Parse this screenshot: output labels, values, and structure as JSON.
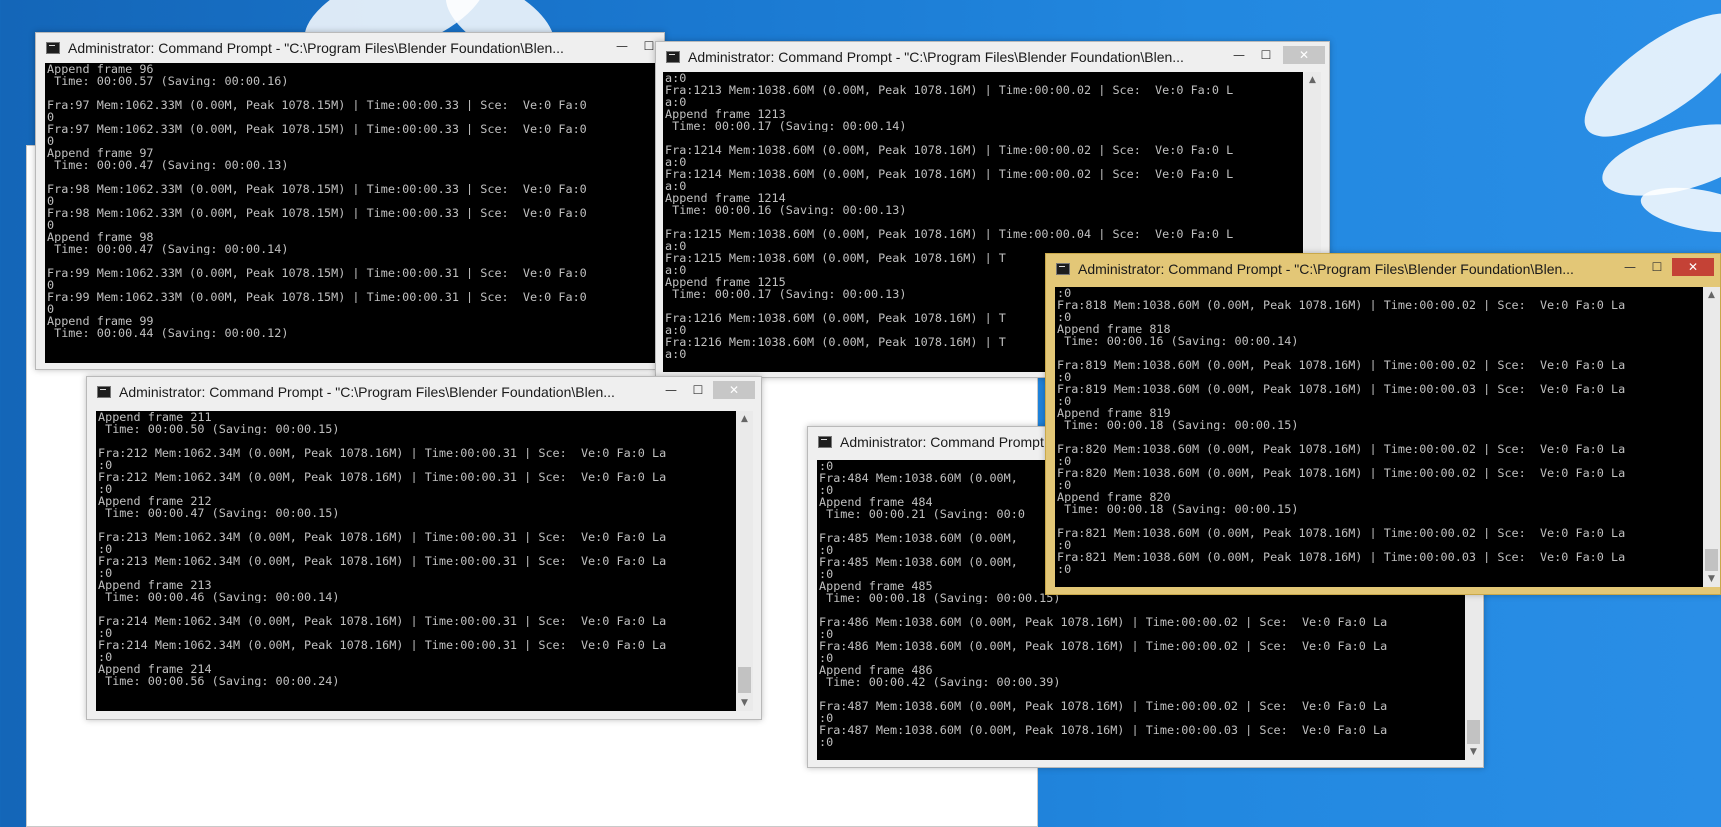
{
  "windows": [
    {
      "id": "w1",
      "title": "Administrator: Command Prompt - \"C:\\Program Files\\Blender Foundation\\Blen...",
      "controls": {
        "minimize": "—",
        "maximize": "☐",
        "close": "✕"
      },
      "lines": [
        "Append frame 96",
        " Time: 00:00.57 (Saving: 00:00.16)",
        "",
        "Fra:97 Mem:1062.33M (0.00M, Peak 1078.15M) | Time:00:00.33 | Sce:  Ve:0 Fa:0",
        "0",
        "Fra:97 Mem:1062.33M (0.00M, Peak 1078.15M) | Time:00:00.33 | Sce:  Ve:0 Fa:0",
        "0",
        "Append frame 97",
        " Time: 00:00.47 (Saving: 00:00.13)",
        "",
        "Fra:98 Mem:1062.33M (0.00M, Peak 1078.15M) | Time:00:00.33 | Sce:  Ve:0 Fa:0",
        "0",
        "Fra:98 Mem:1062.33M (0.00M, Peak 1078.15M) | Time:00:00.33 | Sce:  Ve:0 Fa:0",
        "0",
        "Append frame 98",
        " Time: 00:00.47 (Saving: 00:00.14)",
        "",
        "Fra:99 Mem:1062.33M (0.00M, Peak 1078.15M) | Time:00:00.31 | Sce:  Ve:0 Fa:0",
        "0",
        "Fra:99 Mem:1062.33M (0.00M, Peak 1078.15M) | Time:00:00.31 | Sce:  Ve:0 Fa:0",
        "0",
        "Append frame 99",
        " Time: 00:00.44 (Saving: 00:00.12)"
      ]
    },
    {
      "id": "w2",
      "title": "Administrator: Command Prompt - \"C:\\Program Files\\Blender Foundation\\Blen...",
      "controls": {
        "minimize": "—",
        "maximize": "☐",
        "close": "✕"
      },
      "lines": [
        "a:0",
        "Fra:1213 Mem:1038.60M (0.00M, Peak 1078.16M) | Time:00:00.02 | Sce:  Ve:0 Fa:0 L",
        "a:0",
        "Append frame 1213",
        " Time: 00:00.17 (Saving: 00:00.14)",
        "",
        "Fra:1214 Mem:1038.60M (0.00M, Peak 1078.16M) | Time:00:00.02 | Sce:  Ve:0 Fa:0 L",
        "a:0",
        "Fra:1214 Mem:1038.60M (0.00M, Peak 1078.16M) | Time:00:00.02 | Sce:  Ve:0 Fa:0 L",
        "a:0",
        "Append frame 1214",
        " Time: 00:00.16 (Saving: 00:00.13)",
        "",
        "Fra:1215 Mem:1038.60M (0.00M, Peak 1078.16M) | Time:00:00.04 | Sce:  Ve:0 Fa:0 L",
        "a:0",
        "Fra:1215 Mem:1038.60M (0.00M, Peak 1078.16M) | T",
        "a:0",
        "Append frame 1215",
        " Time: 00:00.17 (Saving: 00:00.13)",
        "",
        "Fra:1216 Mem:1038.60M (0.00M, Peak 1078.16M) | T",
        "a:0",
        "Fra:1216 Mem:1038.60M (0.00M, Peak 1078.16M) | T",
        "a:0"
      ]
    },
    {
      "id": "w3",
      "title": "Administrator: Command Prompt - \"C:\\Program Files\\Blender Foundation\\Blen...",
      "controls": {
        "minimize": "—",
        "maximize": "☐",
        "close": "✕"
      },
      "lines": [
        "Append frame 211",
        " Time: 00:00.50 (Saving: 00:00.15)",
        "",
        "Fra:212 Mem:1062.34M (0.00M, Peak 1078.16M) | Time:00:00.31 | Sce:  Ve:0 Fa:0 La",
        ":0",
        "Fra:212 Mem:1062.34M (0.00M, Peak 1078.16M) | Time:00:00.31 | Sce:  Ve:0 Fa:0 La",
        ":0",
        "Append frame 212",
        " Time: 00:00.47 (Saving: 00:00.15)",
        "",
        "Fra:213 Mem:1062.34M (0.00M, Peak 1078.16M) | Time:00:00.31 | Sce:  Ve:0 Fa:0 La",
        ":0",
        "Fra:213 Mem:1062.34M (0.00M, Peak 1078.16M) | Time:00:00.31 | Sce:  Ve:0 Fa:0 La",
        ":0",
        "Append frame 213",
        " Time: 00:00.46 (Saving: 00:00.14)",
        "",
        "Fra:214 Mem:1062.34M (0.00M, Peak 1078.16M) | Time:00:00.31 | Sce:  Ve:0 Fa:0 La",
        ":0",
        "Fra:214 Mem:1062.34M (0.00M, Peak 1078.16M) | Time:00:00.31 | Sce:  Ve:0 Fa:0 La",
        ":0",
        "Append frame 214",
        " Time: 00:00.56 (Saving: 00:00.24)"
      ]
    },
    {
      "id": "w4",
      "title": "Administrator: Command Prompt",
      "controls": {
        "minimize": "—",
        "maximize": "☐",
        "close": "✕"
      },
      "lines": [
        ":0",
        "Fra:484 Mem:1038.60M (0.00M,",
        ":0",
        "Append frame 484",
        " Time: 00:00.21 (Saving: 00:0",
        "",
        "Fra:485 Mem:1038.60M (0.00M,",
        ":0",
        "Fra:485 Mem:1038.60M (0.00M,",
        ":0",
        "Append frame 485",
        " Time: 00:00.18 (Saving: 00:00.15)",
        "",
        "Fra:486 Mem:1038.60M (0.00M, Peak 1078.16M) | Time:00:00.02 | Sce:  Ve:0 Fa:0 La",
        ":0",
        "Fra:486 Mem:1038.60M (0.00M, Peak 1078.16M) | Time:00:00.02 | Sce:  Ve:0 Fa:0 La",
        ":0",
        "Append frame 486",
        " Time: 00:00.42 (Saving: 00:00.39)",
        "",
        "Fra:487 Mem:1038.60M (0.00M, Peak 1078.16M) | Time:00:00.02 | Sce:  Ve:0 Fa:0 La",
        ":0",
        "Fra:487 Mem:1038.60M (0.00M, Peak 1078.16M) | Time:00:00.03 | Sce:  Ve:0 Fa:0 La",
        ":0"
      ]
    },
    {
      "id": "w5",
      "title": "Administrator: Command Prompt - \"C:\\Program Files\\Blender Foundation\\Blen...",
      "controls": {
        "minimize": "—",
        "maximize": "☐",
        "close": "✕"
      },
      "lines": [
        ":0",
        "Fra:818 Mem:1038.60M (0.00M, Peak 1078.16M) | Time:00:00.02 | Sce:  Ve:0 Fa:0 La",
        ":0",
        "Append frame 818",
        " Time: 00:00.16 (Saving: 00:00.14)",
        "",
        "Fra:819 Mem:1038.60M (0.00M, Peak 1078.16M) | Time:00:00.02 | Sce:  Ve:0 Fa:0 La",
        ":0",
        "Fra:819 Mem:1038.60M (0.00M, Peak 1078.16M) | Time:00:00.03 | Sce:  Ve:0 Fa:0 La",
        ":0",
        "Append frame 819",
        " Time: 00:00.18 (Saving: 00:00.15)",
        "",
        "Fra:820 Mem:1038.60M (0.00M, Peak 1078.16M) | Time:00:00.02 | Sce:  Ve:0 Fa:0 La",
        ":0",
        "Fra:820 Mem:1038.60M (0.00M, Peak 1078.16M) | Time:00:00.02 | Sce:  Ve:0 Fa:0 La",
        ":0",
        "Append frame 820",
        " Time: 00:00.18 (Saving: 00:00.15)",
        "",
        "Fra:821 Mem:1038.60M (0.00M, Peak 1078.16M) | Time:00:00.02 | Sce:  Ve:0 Fa:0 La",
        ":0",
        "Fra:821 Mem:1038.60M (0.00M, Peak 1078.16M) | Time:00:00.03 | Sce:  Ve:0 Fa:0 La",
        ":0"
      ]
    }
  ]
}
